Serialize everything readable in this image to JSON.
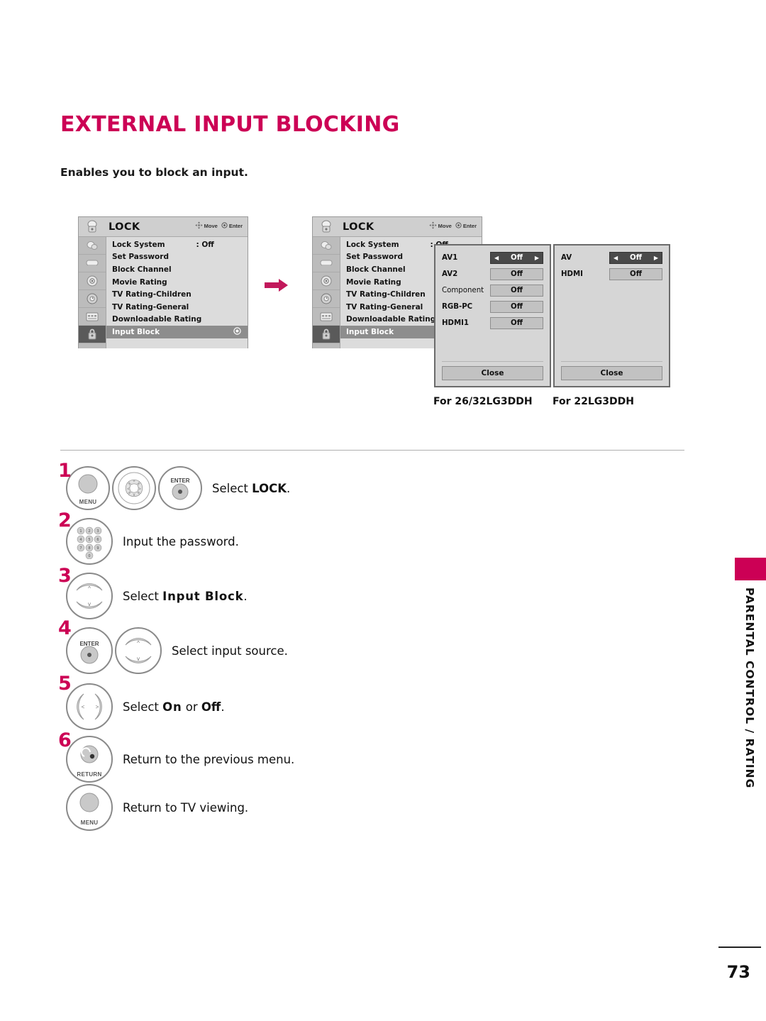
{
  "page": {
    "title": "EXTERNAL INPUT BLOCKING",
    "subtitle": "Enables you to block an input.",
    "number": "73",
    "side_label": "PARENTAL CONTROL / RATING",
    "accent_color": "#cc0055"
  },
  "osd": {
    "title": "LOCK",
    "hint_move": "Move",
    "hint_enter": "Enter",
    "menu_items": [
      {
        "label": "Lock System",
        "value": ": Off"
      },
      {
        "label": "Set Password",
        "value": ""
      },
      {
        "label": "Block Channel",
        "value": ""
      },
      {
        "label": "Movie Rating",
        "value": ""
      },
      {
        "label": "TV Rating-Children",
        "value": ""
      },
      {
        "label": "TV Rating-General",
        "value": ""
      },
      {
        "label": "Downloadable Rating",
        "value": ""
      },
      {
        "label": "Input Block",
        "value": ""
      }
    ],
    "selected_index": 7,
    "sidebar_icons": [
      "picture-icon",
      "audio-icon",
      "time-icon",
      "setup-icon",
      "option-icon",
      "lock-icon"
    ]
  },
  "popup_left": {
    "caption": "For 26/32LG3DDH",
    "close_label": "Close",
    "rows": [
      {
        "label": "AV1",
        "value": "Off",
        "active": true
      },
      {
        "label": "AV2",
        "value": "Off",
        "active": false
      },
      {
        "label": "Component",
        "value": "Off",
        "active": false
      },
      {
        "label": "RGB-PC",
        "value": "Off",
        "active": false
      },
      {
        "label": "HDMI1",
        "value": "Off",
        "active": false
      }
    ]
  },
  "popup_right": {
    "caption": "For 22LG3DDH",
    "close_label": "Close",
    "rows": [
      {
        "label": "AV",
        "value": "Off",
        "active": true
      },
      {
        "label": "HDMI",
        "value": "Off",
        "active": false
      }
    ]
  },
  "steps": [
    {
      "number": "1",
      "buttons": [
        "menu-button",
        "navigation-wheel-button",
        "enter-button"
      ],
      "button_labels": [
        "MENU",
        "",
        "ENTER"
      ],
      "text_prefix": "Select ",
      "text_bold": "LOCK",
      "text_suffix": "."
    },
    {
      "number": "2",
      "buttons": [
        "number-pad-button"
      ],
      "button_labels": [
        ""
      ],
      "text_prefix": "Input the password.",
      "text_bold": "",
      "text_suffix": ""
    },
    {
      "number": "3",
      "buttons": [
        "up-down-button"
      ],
      "button_labels": [
        ""
      ],
      "text_prefix": "Select ",
      "text_bold": "Input Block",
      "text_suffix": "."
    },
    {
      "number": "4",
      "buttons": [
        "enter-button",
        "up-down-button"
      ],
      "button_labels": [
        "ENTER",
        ""
      ],
      "text_prefix": "Select input source.",
      "text_bold": "",
      "text_suffix": ""
    },
    {
      "number": "5",
      "buttons": [
        "left-right-button"
      ],
      "button_labels": [
        ""
      ],
      "text_prefix": "Select ",
      "text_bold": "On",
      "text_mid": " or ",
      "text_bold2": "Off",
      "text_suffix": "."
    },
    {
      "number": "6",
      "buttons": [
        "return-button"
      ],
      "button_labels": [
        "RETURN"
      ],
      "text_prefix": "Return to the previous menu.",
      "text_bold": "",
      "text_suffix": ""
    },
    {
      "number": "",
      "buttons": [
        "menu-button"
      ],
      "button_labels": [
        "MENU"
      ],
      "text_prefix": "Return to TV viewing.",
      "text_bold": "",
      "text_suffix": ""
    }
  ]
}
